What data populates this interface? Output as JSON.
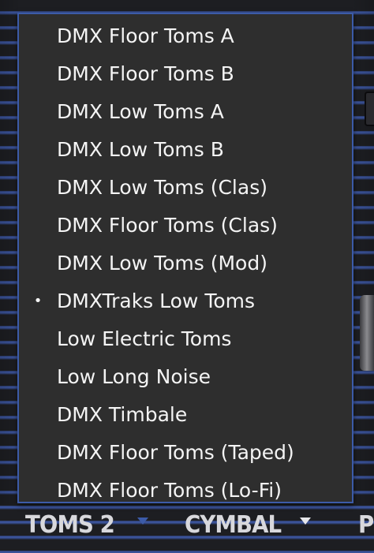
{
  "dropdown": {
    "selected_index": 7,
    "selected_marker": "•",
    "items": [
      {
        "label": "DMX Floor Toms A",
        "selected": false
      },
      {
        "label": "DMX Floor Toms B",
        "selected": false
      },
      {
        "label": "DMX Low Toms A",
        "selected": false
      },
      {
        "label": "DMX Low Toms B",
        "selected": false
      },
      {
        "label": "DMX Low Toms (Clas)",
        "selected": false
      },
      {
        "label": "DMX Floor Toms (Clas)",
        "selected": false
      },
      {
        "label": "DMX Low Toms (Mod)",
        "selected": false
      },
      {
        "label": "DMXTraks Low Toms",
        "selected": true
      },
      {
        "label": "Low Electric Toms",
        "selected": false
      },
      {
        "label": "Low Long Noise",
        "selected": false
      },
      {
        "label": "DMX Timbale",
        "selected": false
      },
      {
        "label": "DMX Floor Toms (Taped)",
        "selected": false
      },
      {
        "label": "DMX Floor Toms (Lo-Fi)",
        "selected": false
      }
    ]
  },
  "bottom_bar": {
    "toms2_label": "TOMS 2",
    "cymbal_label": "CYMBAL",
    "partial_label": "P",
    "toms2_arrow_color": "#3c5ba8",
    "cymbal_arrow_color": "#e6e6ea"
  },
  "colors": {
    "menu_background": "#2e2e2e",
    "menu_border": "#3c5ba8",
    "menu_text": "#f4f4f4",
    "panel_stripe": "#3f5aa8"
  }
}
